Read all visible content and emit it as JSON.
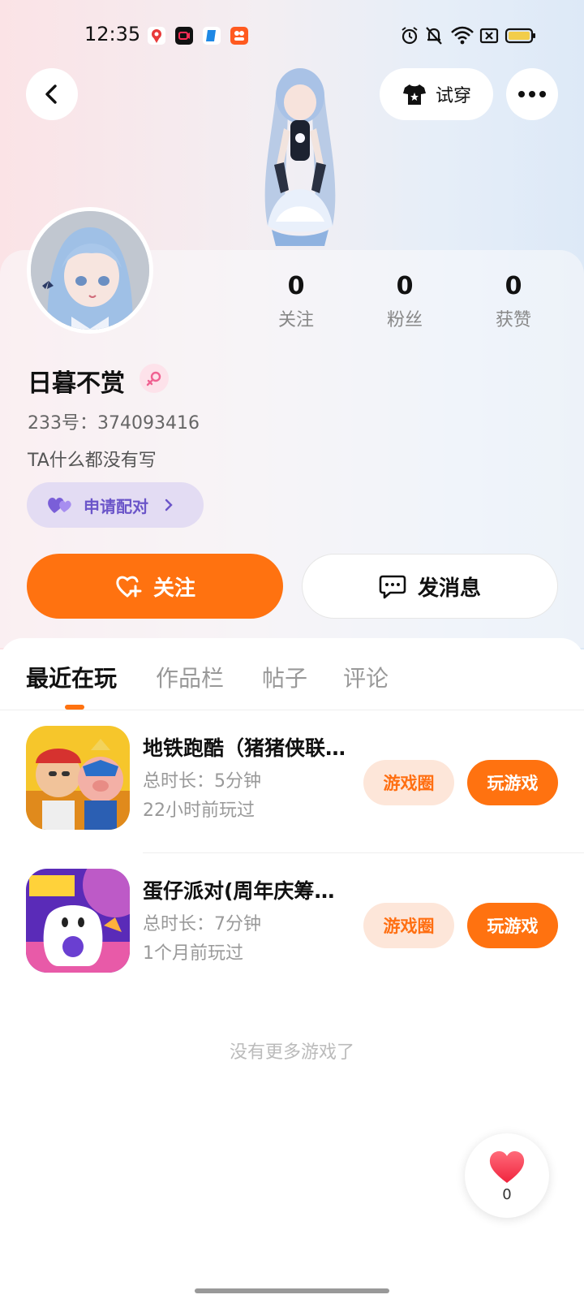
{
  "status_bar": {
    "time": "12:35"
  },
  "header": {
    "tryon_label": "试穿"
  },
  "profile": {
    "name": "日暮不赏",
    "id_line": "233号：374093416",
    "bio": "TA什么都没有写",
    "pair_label": "申请配对",
    "stats": [
      {
        "value": "0",
        "label": "关注"
      },
      {
        "value": "0",
        "label": "粉丝"
      },
      {
        "value": "0",
        "label": "获赞"
      }
    ],
    "follow_label": "关注",
    "message_label": "发消息"
  },
  "tabs": [
    {
      "label": "最近在玩",
      "active": true
    },
    {
      "label": "作品栏",
      "active": false
    },
    {
      "label": "帖子",
      "active": false
    },
    {
      "label": "评论",
      "active": false
    }
  ],
  "games": [
    {
      "title": "地铁跑酷（猪猪侠联动版）",
      "duration": "总时长：5分钟",
      "last_played": "22小时前玩过",
      "circle_label": "游戏圈",
      "play_label": "玩游戏"
    },
    {
      "title": "蛋仔派对(周年庆筹备中)",
      "duration": "总时长：7分钟",
      "last_played": "1个月前玩过",
      "circle_label": "游戏圈",
      "play_label": "玩游戏"
    }
  ],
  "footer": {
    "no_more": "没有更多游戏了"
  },
  "like_fab": {
    "count": "0"
  },
  "colors": {
    "accent": "#ff7210",
    "pair_bg": "#e3dcf3",
    "pair_text": "#6b55c9"
  }
}
